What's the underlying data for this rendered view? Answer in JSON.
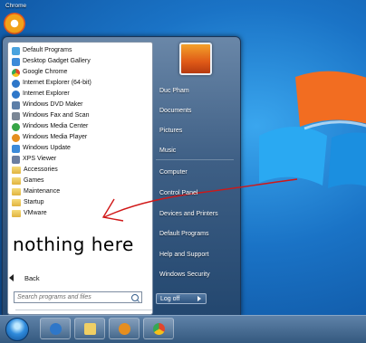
{
  "desktop": {
    "icon_label": "Chrome"
  },
  "programs": [
    {
      "label": "Default Programs",
      "icon": "default-programs-icon",
      "color": "#4aa3df"
    },
    {
      "label": "Desktop Gadget Gallery",
      "icon": "gadget-gallery-icon",
      "color": "#3c8ad9"
    },
    {
      "label": "Google Chrome",
      "icon": "chrome-icon",
      "color": "#e1462b"
    },
    {
      "label": "Internet Explorer (64-bit)",
      "icon": "internet-explorer-icon",
      "color": "#2e77c9"
    },
    {
      "label": "Internet Explorer",
      "icon": "internet-explorer-icon",
      "color": "#2e77c9"
    },
    {
      "label": "Windows DVD Maker",
      "icon": "dvd-maker-icon",
      "color": "#5d7fa8"
    },
    {
      "label": "Windows Fax and Scan",
      "icon": "fax-scan-icon",
      "color": "#7b8796"
    },
    {
      "label": "Windows Media Center",
      "icon": "media-center-icon",
      "color": "#37a547"
    },
    {
      "label": "Windows Media Player",
      "icon": "media-player-icon",
      "color": "#e58e1f"
    },
    {
      "label": "Windows Update",
      "icon": "windows-update-icon",
      "color": "#3c8ad9"
    },
    {
      "label": "XPS Viewer",
      "icon": "xps-viewer-icon",
      "color": "#6b7ea0"
    }
  ],
  "folders": [
    {
      "label": "Accessories"
    },
    {
      "label": "Games"
    },
    {
      "label": "Maintenance"
    },
    {
      "label": "Startup"
    },
    {
      "label": "VMware"
    }
  ],
  "annotation": {
    "text": "nothing here",
    "color": "#d01717"
  },
  "left_pane": {
    "back_label": "Back",
    "search_placeholder": "Search programs and files"
  },
  "right_pane": {
    "user": "Duc Pham",
    "items": [
      "Documents",
      "Pictures",
      "Music",
      "Computer",
      "Control Panel",
      "Devices and Printers",
      "Default Programs",
      "Help and Support",
      "Windows Security"
    ],
    "logoff_label": "Log off"
  },
  "taskbar": {
    "pinned": [
      "internet-explorer-icon",
      "file-explorer-icon",
      "media-player-icon",
      "chrome-icon"
    ]
  }
}
